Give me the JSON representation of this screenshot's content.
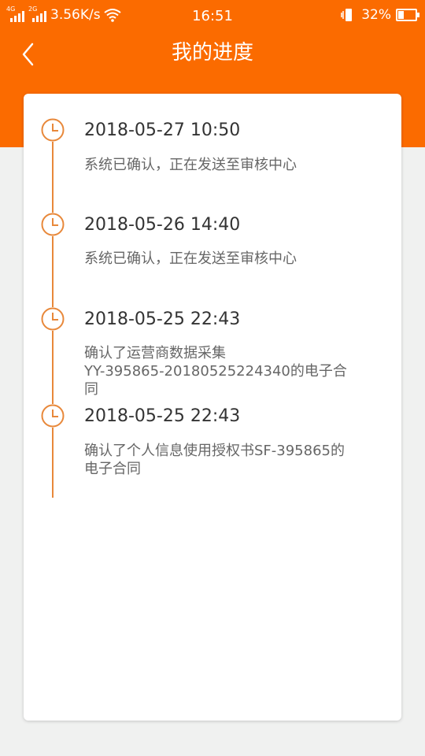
{
  "status_bar": {
    "net_1": "4G",
    "net_2": "2G",
    "speed": "3.56K/s",
    "time": "16:51",
    "battery": "32%",
    "battery_level": 0.32
  },
  "header": {
    "title": "我的进度"
  },
  "colors": {
    "accent": "#fb6b00",
    "timeline": "#e8883a"
  },
  "timeline": [
    {
      "time": "2018-05-27 10:50",
      "desc": "系统已确认，正在发送至审核中心"
    },
    {
      "time": "2018-05-26 14:40",
      "desc": "系统已确认，正在发送至审核中心"
    },
    {
      "time": "2018-05-25 22:43",
      "desc_lines": [
        "确认了运营商数据采集",
        "YY-395865-20180525224340的电子合",
        "同"
      ]
    },
    {
      "time": "2018-05-25 22:43",
      "desc_lines": [
        "确认了个人信息使用授权书SF-395865的",
        "电子合同"
      ]
    }
  ]
}
